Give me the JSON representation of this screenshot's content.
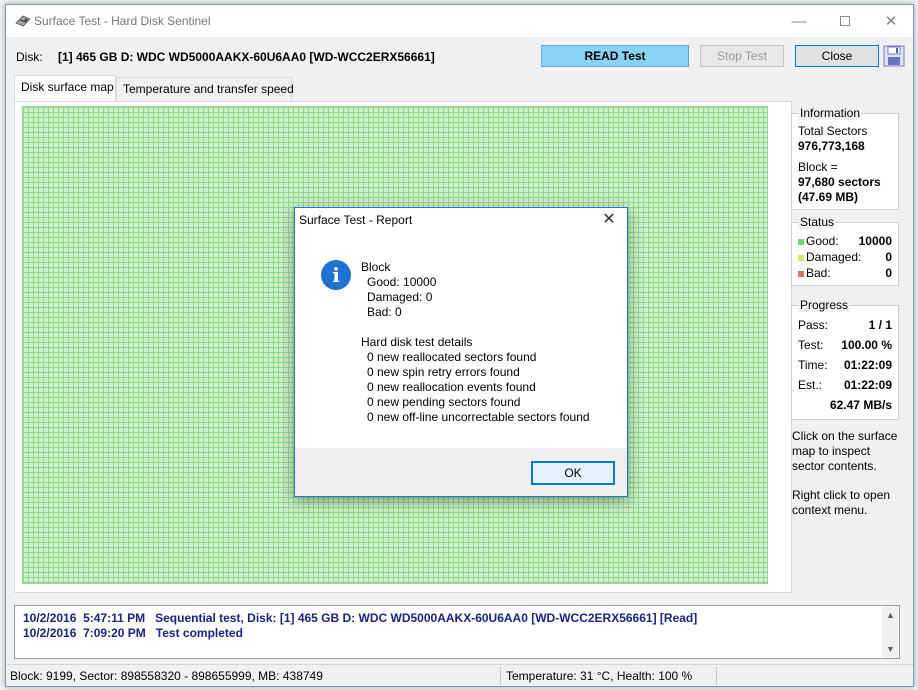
{
  "window": {
    "title": "Surface Test - Hard Disk Sentinel"
  },
  "disk": {
    "label": "Disk:",
    "value": "[1] 465 GB D: WDC WD5000AAKX-60U6AA0 [WD-WCC2ERX56661]"
  },
  "toolbar": {
    "read_test_label": "READ Test",
    "stop_test_label": "Stop Test",
    "close_label": "Close"
  },
  "tabs": [
    {
      "label": "Disk surface map"
    },
    {
      "label": "Temperature and transfer speed"
    }
  ],
  "information": {
    "legend": "Information",
    "total_sectors_label": "Total Sectors",
    "total_sectors_value": "976,773,168",
    "block_label": "Block =",
    "block_sectors": "97,680 sectors",
    "block_mb": "(47.69 MB)"
  },
  "status": {
    "legend": "Status",
    "good_label": "Good:",
    "good_value": "10000",
    "damaged_label": "Damaged:",
    "damaged_value": "0",
    "bad_label": "Bad:",
    "bad_value": "0",
    "colors": {
      "good": "#7fd17a",
      "damaged": "#d6e86a",
      "bad": "#e07070"
    }
  },
  "progress": {
    "legend": "Progress",
    "pass_label": "Pass:",
    "pass_value": "1 / 1",
    "test_label": "Test:",
    "test_value": "100.00 %",
    "time_label": "Time:",
    "time_value": "01:22:09",
    "est_label": "Est.:",
    "est_value": "01:22:09",
    "speed_value": "62.47 MB/s"
  },
  "hints": {
    "click_line1": "Click on the surface",
    "click_line2": "map to inspect",
    "click_line3": "sector contents.",
    "right_line1": "Right click to open",
    "right_line2": "context menu."
  },
  "log": [
    {
      "date": "10/2/2016",
      "time": "5:47:11 PM",
      "text": "Sequential test, Disk: [1] 465 GB D: WDC WD5000AAKX-60U6AA0 [WD-WCC2ERX56661] [Read]"
    },
    {
      "date": "10/2/2016",
      "time": "7:09:20 PM",
      "text": "Test completed"
    }
  ],
  "statusbar": {
    "block_info": "Block: 9199, Sector: 898558320 - 898655999, MB: 438749",
    "temp_health": "Temperature: 31  °C,  Health: 100 %"
  },
  "dialog": {
    "title": "Surface Test - Report",
    "block_heading": "Block",
    "good": "Good: 10000",
    "damaged": "Damaged: 0",
    "bad": "Bad: 0",
    "details_heading": "Hard disk test details",
    "d1": "0 new reallocated sectors found",
    "d2": "0 new spin retry errors found",
    "d3": "0 new reallocation events found",
    "d4": "0 new pending sectors found",
    "d5": "0 new off-line uncorrectable sectors found",
    "ok_label": "OK"
  }
}
